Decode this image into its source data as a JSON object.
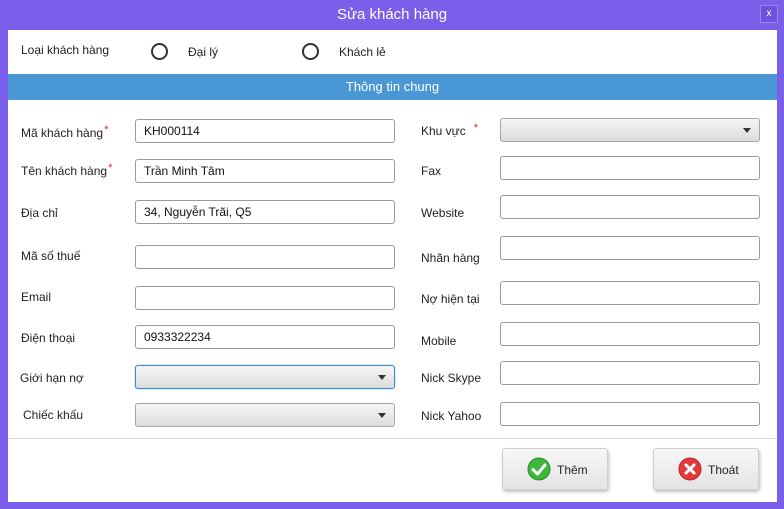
{
  "window": {
    "title": "Sửa khách hàng",
    "close_label": "x"
  },
  "customer_type": {
    "label": "Loại khách hàng",
    "options": [
      "Đại lý",
      "Khách lẻ"
    ]
  },
  "section": {
    "title": "Thông tin chung"
  },
  "left_fields": {
    "ma_kh": {
      "label": "Mã khách hàng",
      "value": "KH000114",
      "required": "*"
    },
    "ten_kh": {
      "label": "Tên khách hàng",
      "value": "Trần Minh Tâm",
      "required": "*"
    },
    "dia_chi": {
      "label": "Địa chỉ",
      "value": "34, Nguyễn Trãi, Q5"
    },
    "ma_so_thue": {
      "label": "Mã số thuế",
      "value": ""
    },
    "email": {
      "label": "Email",
      "value": ""
    },
    "dien_thoai": {
      "label": "Điện thoại",
      "value": "0933322234"
    },
    "gioi_han_no": {
      "label": "Giới hạn nợ",
      "value": ""
    },
    "chiet_khau": {
      "label": "Chiếc khấu",
      "value": ""
    }
  },
  "right_fields": {
    "khu_vuc": {
      "label": "Khu vực",
      "value": "",
      "required": "*"
    },
    "fax": {
      "label": "Fax",
      "value": ""
    },
    "website": {
      "label": "Website",
      "value": ""
    },
    "nhan_hang": {
      "label": "Nhãn hàng",
      "value": ""
    },
    "no_hien_tai": {
      "label": "Nợ hiện tại",
      "value": ""
    },
    "mobile": {
      "label": "Mobile",
      "value": ""
    },
    "skype": {
      "label": "Nick  Skype",
      "value": ""
    },
    "yahoo": {
      "label": "Nick Yahoo",
      "value": ""
    }
  },
  "buttons": {
    "add_label": "Thêm",
    "exit_label": "Thoát"
  },
  "colors": {
    "window_frame": "#7b5ee9",
    "section_bar": "#4a97d6",
    "required": "#e02020",
    "add_icon": "#3cb83c",
    "exit_icon": "#e23a3a"
  }
}
